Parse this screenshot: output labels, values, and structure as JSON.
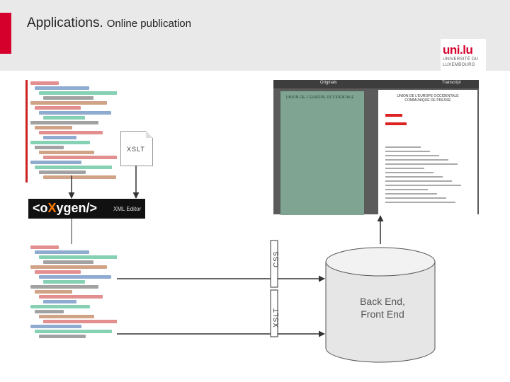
{
  "header": {
    "title_main": "Applications.",
    "title_sub": "Online publication",
    "logo": {
      "word": "uni.lu",
      "line1": "UNIVERSITÉ DU",
      "line2": "LUXEMBOURG"
    }
  },
  "tools": {
    "xml_doc_label": "XSLT",
    "oxygen_brand_prefix": "<o",
    "oxygen_brand_x": "X",
    "oxygen_brand_suffix": "ygen/>",
    "oxygen_tag": "XML Editor"
  },
  "viewer": {
    "tab_left": "Originals",
    "tab_right": "Transcript",
    "scan_title": "UNION DE L'EUROPE OCCIDENTALE",
    "page_title_line1": "UNION DE L'EUROPE OCCIDENTALE",
    "page_title_line2": "COMMUNIQUÉ DE PRESSE"
  },
  "labels": {
    "css": "CSS",
    "xslt": "XSLT"
  },
  "database": {
    "line1": "Back End,",
    "line2": "Front End"
  },
  "colors": {
    "accent": "#d5002b",
    "band": "#e9e9e9"
  }
}
